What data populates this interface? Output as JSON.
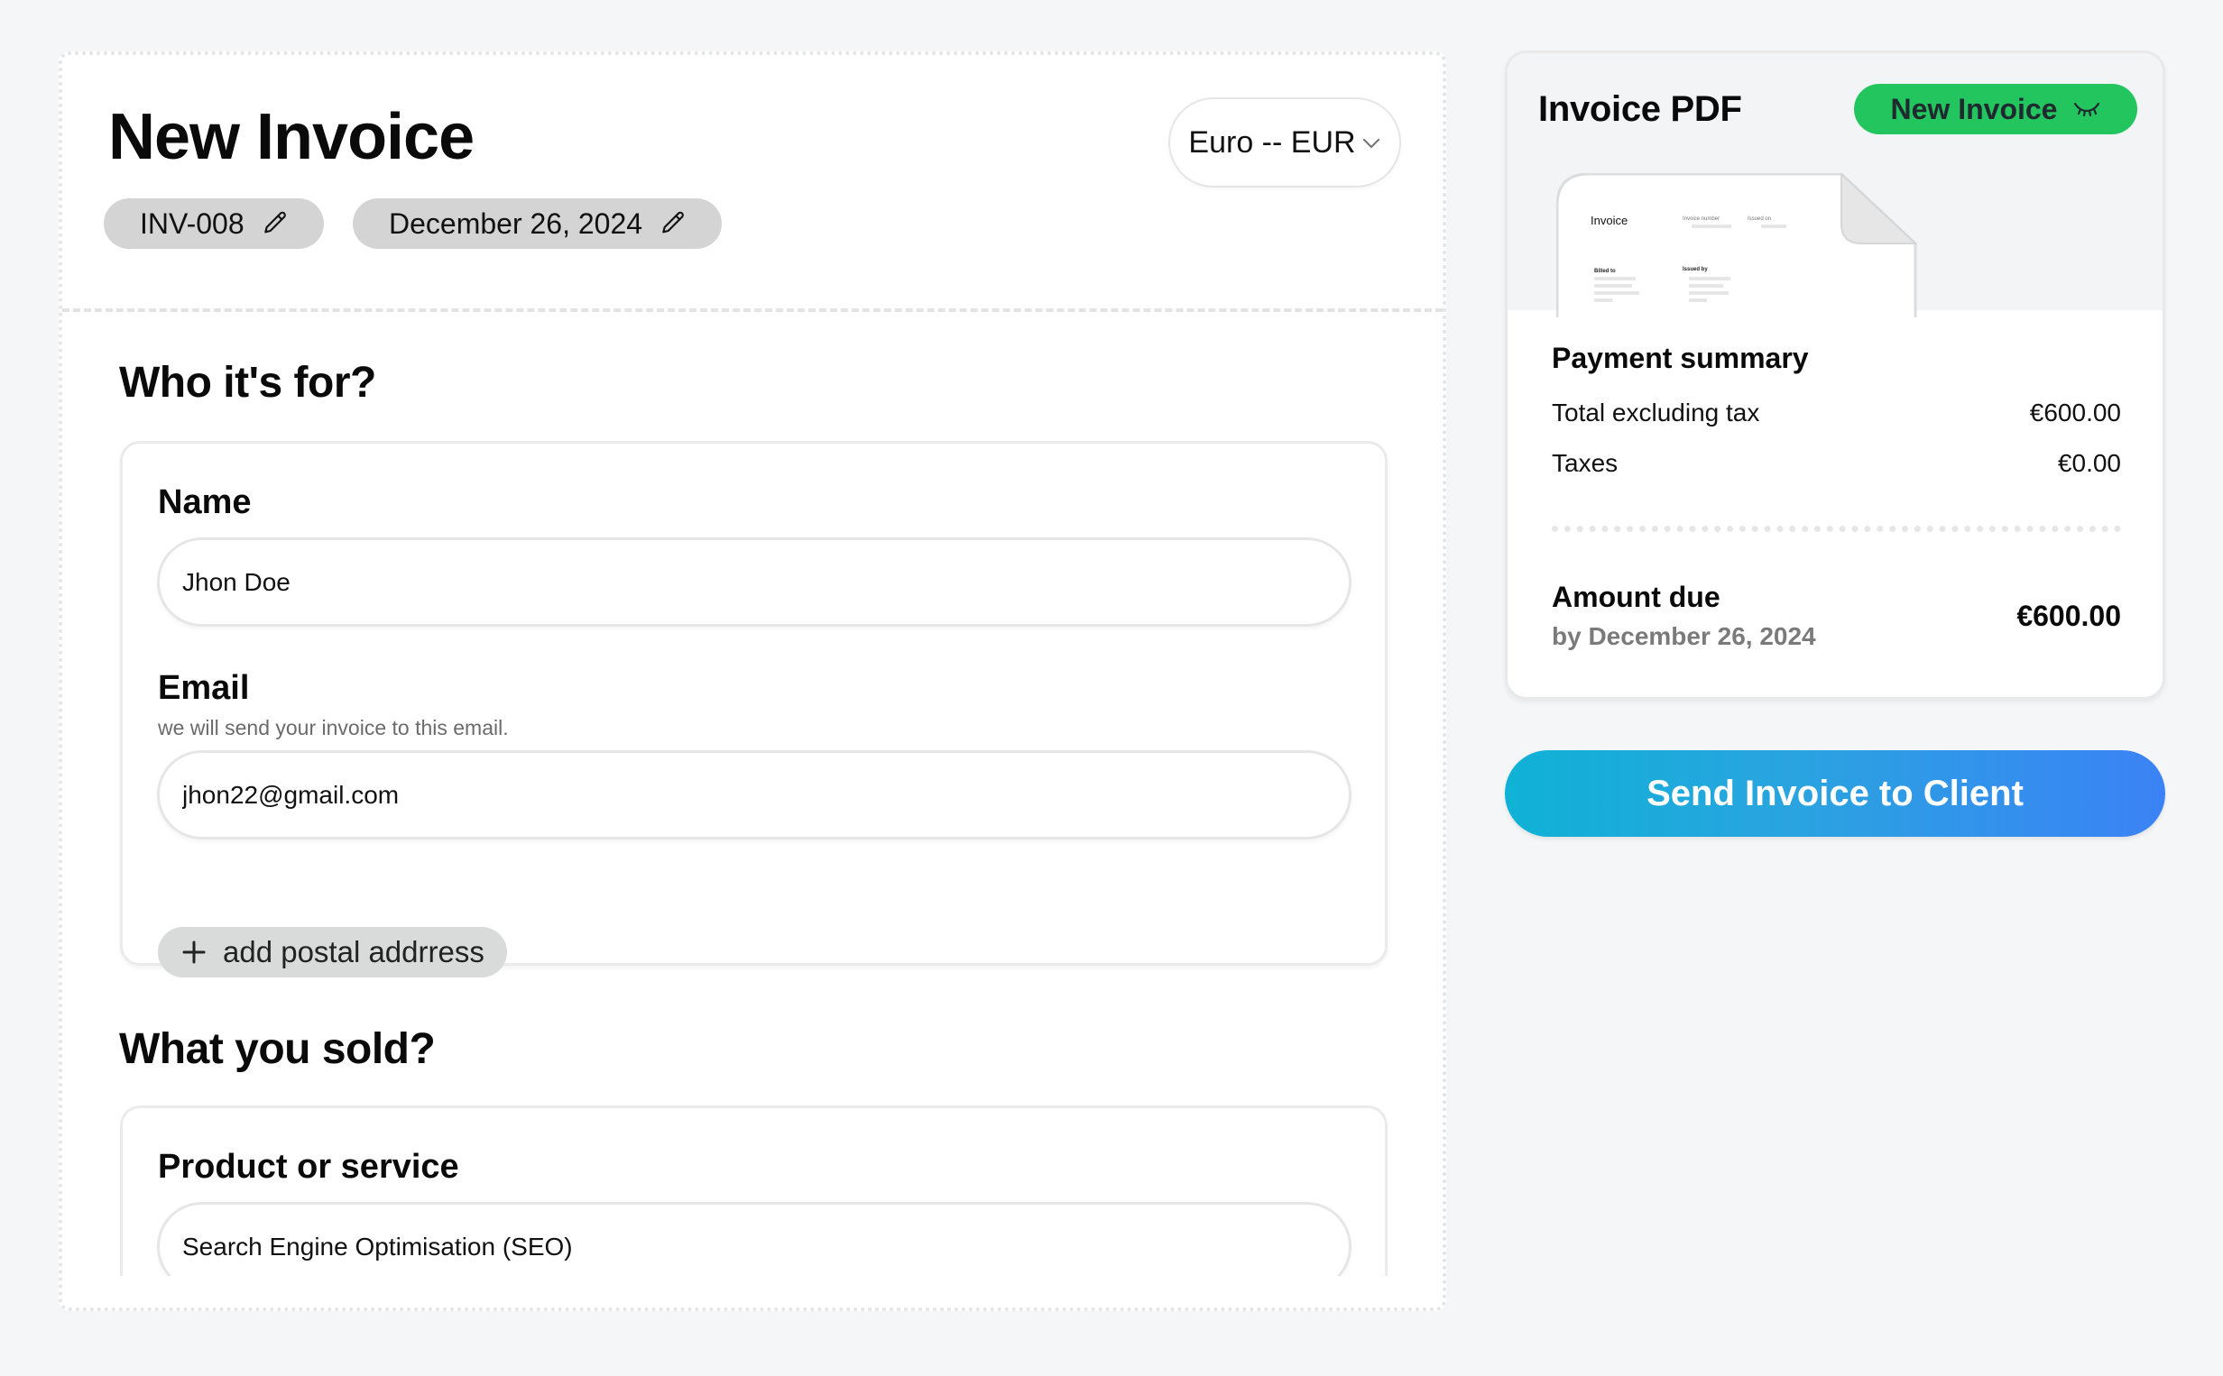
{
  "editor": {
    "title": "New Invoice",
    "invoice_number": "INV-008",
    "invoice_date": "December 26, 2024",
    "currency": {
      "selected": "Euro -- EUR"
    },
    "sections": {
      "recipient": {
        "title": "Who it's for?",
        "name_label": "Name",
        "name_value": "Jhon Doe",
        "email_label": "Email",
        "email_hint": "we will send your invoice to this email.",
        "email_value": "jhon22@gmail.com",
        "add_address_label": "add postal addrress"
      },
      "items": {
        "title": "What you sold?",
        "product_label": "Product or service",
        "product_value": "Search Engine Optimisation (SEO)"
      }
    }
  },
  "preview": {
    "title": "Invoice PDF",
    "status_badge": "New Invoice",
    "status_color": "#22c55e",
    "document": {
      "heading": "Invoice",
      "invoice_number_label": "Invoice number",
      "issued_on_label": "Issued on",
      "billed_to_label": "Billed to",
      "issued_by_label": "Issued by"
    },
    "summary": {
      "title": "Payment summary",
      "rows": [
        {
          "label": "Total excluding tax",
          "value": "€600.00"
        },
        {
          "label": "Taxes",
          "value": "€0.00"
        }
      ],
      "amount_due_label": "Amount due",
      "amount_due_date": "by December 26, 2024",
      "amount_due_value": "€600.00"
    }
  },
  "actions": {
    "send_label": "Send Invoice to Client",
    "send_gradient": [
      "#0fb2d6",
      "#3b82f6"
    ]
  }
}
